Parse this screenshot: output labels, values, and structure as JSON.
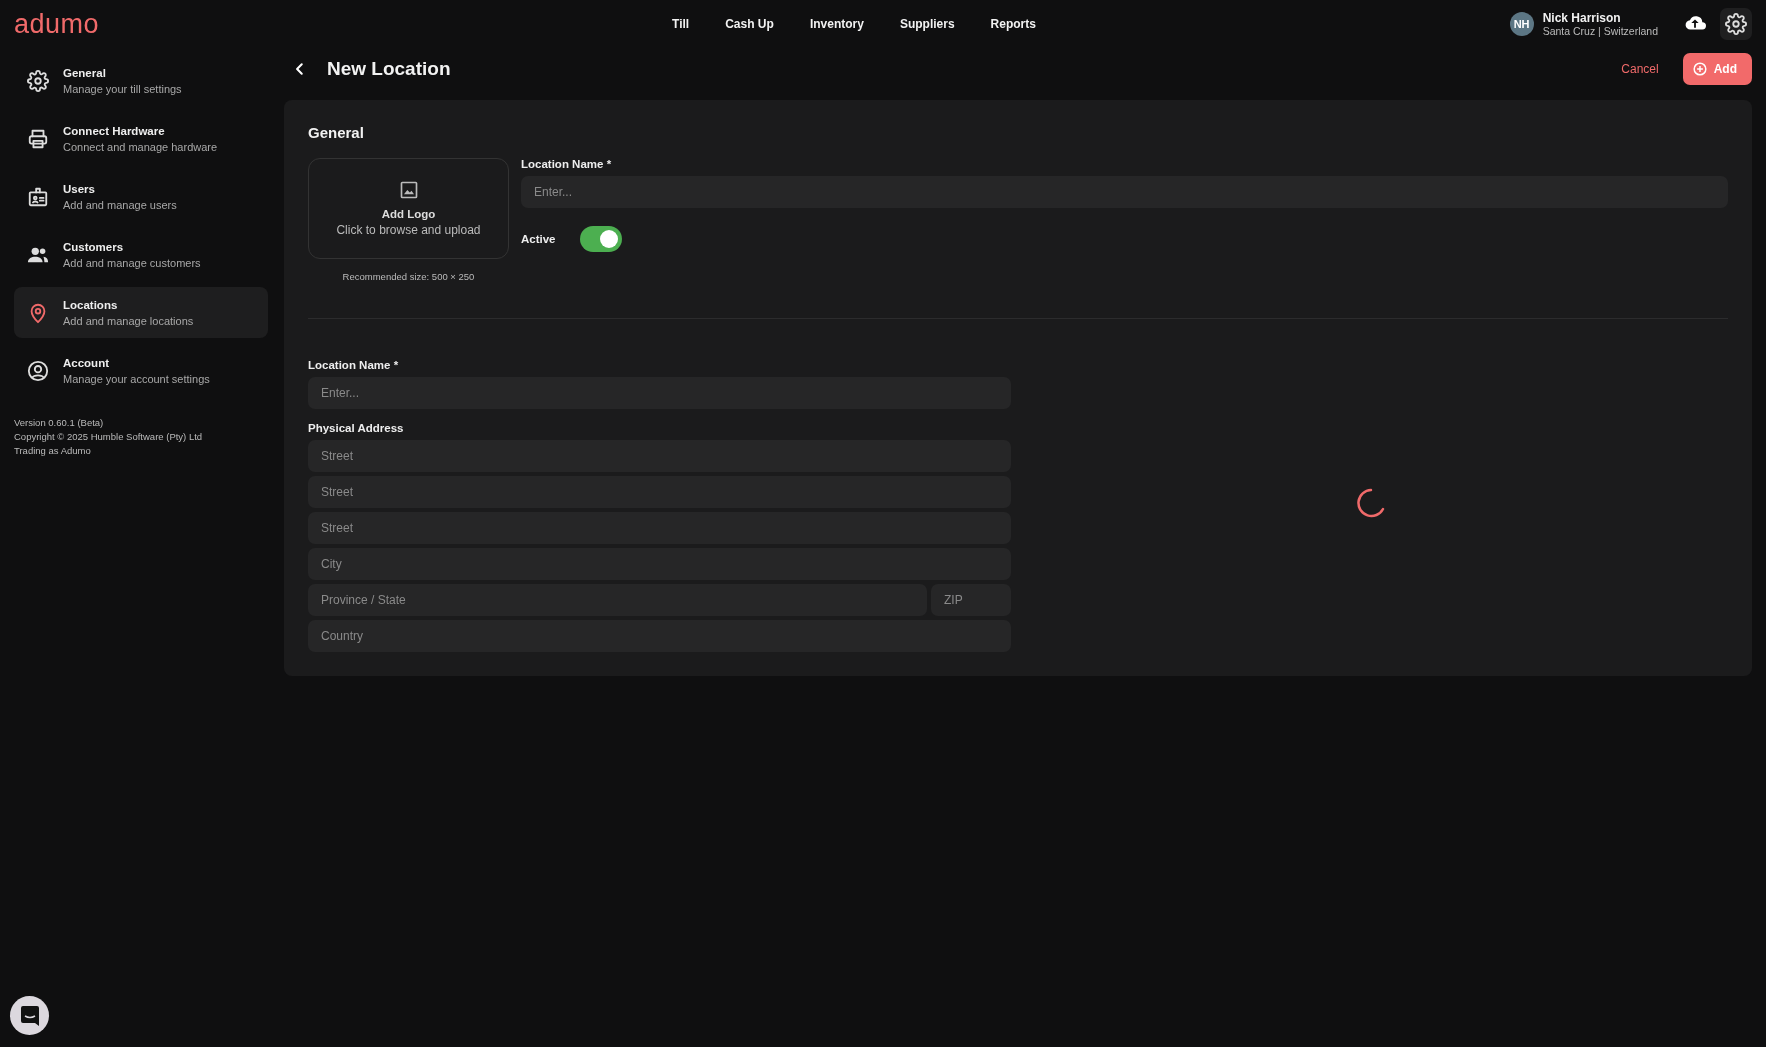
{
  "logo": "adumo",
  "nav": [
    {
      "label": "Till",
      "selected": false
    },
    {
      "label": "Cash Up",
      "selected": false
    },
    {
      "label": "Inventory",
      "selected": false
    },
    {
      "label": "Suppliers",
      "selected": false
    },
    {
      "label": "Reports",
      "selected": false
    }
  ],
  "user": {
    "initials": "NH",
    "name": "Nick Harrison",
    "location": "Santa Cruz | Switzerland"
  },
  "sidebar": {
    "items": [
      {
        "title": "General",
        "subtitle": "Manage your till settings",
        "selected": false
      },
      {
        "title": "Connect Hardware",
        "subtitle": "Connect and manage hardware",
        "selected": false
      },
      {
        "title": "Users",
        "subtitle": "Add and manage users",
        "selected": false
      },
      {
        "title": "Customers",
        "subtitle": "Add and manage customers",
        "selected": false
      },
      {
        "title": "Locations",
        "subtitle": "Add and manage locations",
        "selected": true
      },
      {
        "title": "Account",
        "subtitle": "Manage your account settings",
        "selected": false
      }
    ],
    "footer": [
      "Version 0.60.1 (Beta)",
      "Copyright © 2025 Humble Software (Pty) Ltd",
      "Trading as Adumo"
    ]
  },
  "page": {
    "title": "New Location",
    "cancel": "Cancel",
    "add": "Add"
  },
  "general": {
    "heading": "General",
    "logo_title": "Add Logo",
    "logo_hint": "Click to browse and upload",
    "logo_size": "Recommended size: 500 × 250",
    "name_label": "Location Name *",
    "name_placeholder": "Enter...",
    "active_label": "Active",
    "active": true
  },
  "details": {
    "name_label": "Location Name *",
    "name_placeholder": "Enter...",
    "address_label": "Physical Address",
    "address_fields": [
      {
        "placeholder": "Street"
      },
      {
        "placeholder": "Street"
      },
      {
        "placeholder": "Street"
      },
      {
        "placeholder": "City"
      },
      [
        {
          "placeholder": "Province / State"
        },
        {
          "placeholder": "ZIP"
        }
      ],
      {
        "placeholder": "Country"
      }
    ]
  }
}
